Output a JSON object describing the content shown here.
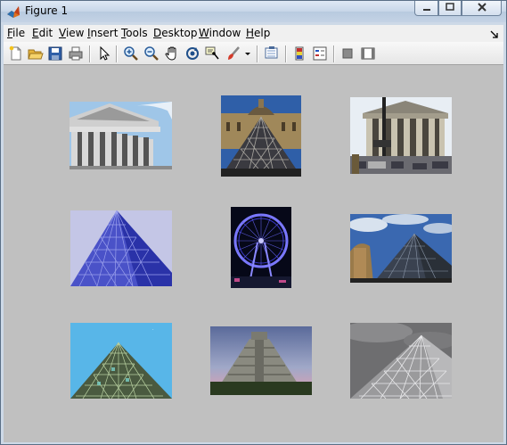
{
  "window": {
    "title": "Figure 1"
  },
  "menu": {
    "items": [
      "File",
      "Edit",
      "View",
      "Insert",
      "Tools",
      "Desktop",
      "Window",
      "Help"
    ],
    "underline": [
      "F",
      "E",
      "V",
      "I",
      "T",
      "D",
      "W",
      "H"
    ]
  },
  "toolbar": {
    "buttons": [
      "new-figure",
      "open-file",
      "save-figure",
      "print-figure",
      "edit-plot",
      "zoom-in",
      "zoom-out",
      "pan",
      "rotate-3d",
      "data-cursor",
      "brush",
      "brush-dropdown",
      "link-plot",
      "insert-colorbar",
      "insert-legend",
      "hide-plot-tools",
      "show-plot-tools"
    ]
  },
  "images": [
    {
      "name": "pantheon-columns"
    },
    {
      "name": "louvre-pyramid-palace"
    },
    {
      "name": "madeleine-church"
    },
    {
      "name": "blue-glass-pyramid"
    },
    {
      "name": "ferris-wheel-night"
    },
    {
      "name": "pyramid-sky-clouds"
    },
    {
      "name": "pyramid-green-blue-sky"
    },
    {
      "name": "chichen-itza-pyramid"
    },
    {
      "name": "gray-glass-pyramid"
    }
  ],
  "colors": {
    "figure_background": "#c0c0c0",
    "menubar": "#f0f0f0"
  }
}
